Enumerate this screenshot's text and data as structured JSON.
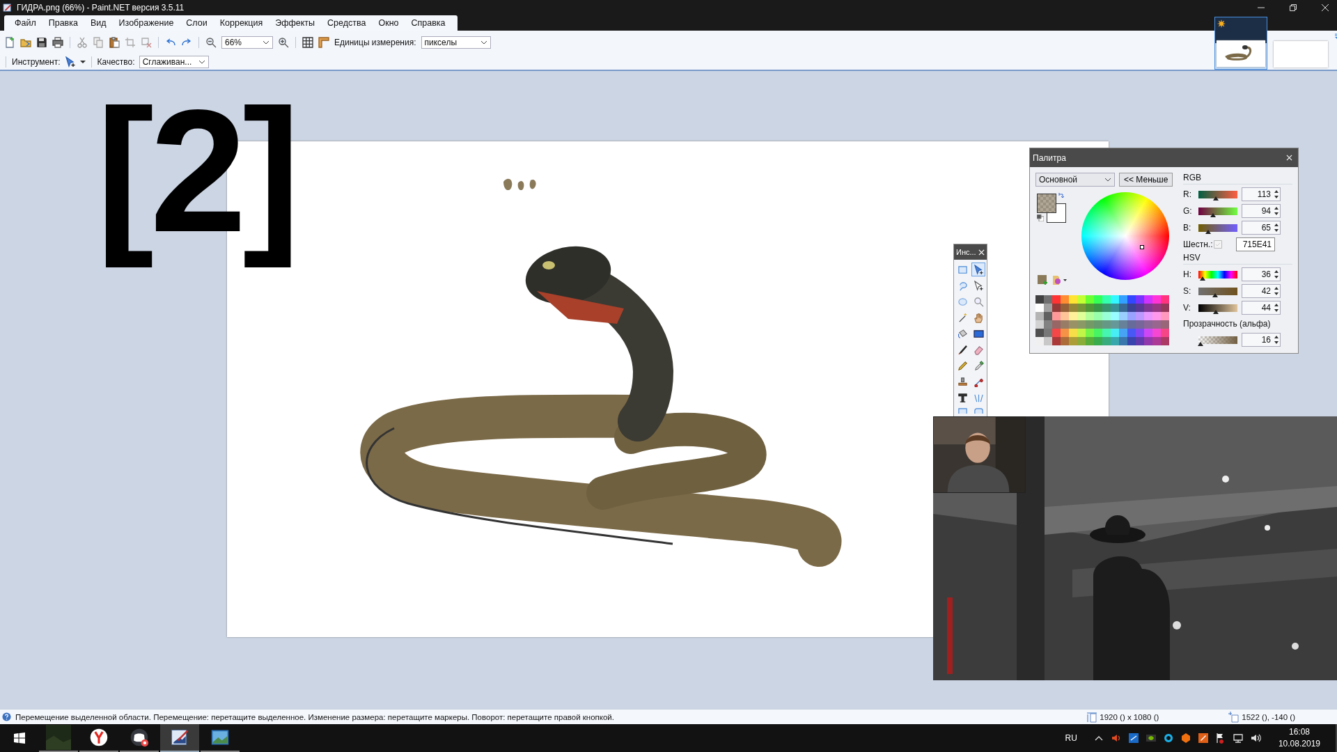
{
  "window": {
    "title": "ГИДРА.png (66%) - Paint.NET версия 3.5.11"
  },
  "menu": [
    {
      "label": "Файл"
    },
    {
      "label": "Правка"
    },
    {
      "label": "Вид"
    },
    {
      "label": "Изображение"
    },
    {
      "label": "Слои"
    },
    {
      "label": "Коррекция"
    },
    {
      "label": "Эффекты"
    },
    {
      "label": "Средства"
    },
    {
      "label": "Окно"
    },
    {
      "label": "Справка"
    }
  ],
  "image_tabs": [
    {
      "selected": true
    },
    {
      "selected": false
    }
  ],
  "toolbar": {
    "zoom": "66%",
    "units_label": "Единицы измерения:",
    "units": "пикселы"
  },
  "tool_bar": {
    "tool_label": "Инструмент:",
    "quality_label": "Качество:",
    "quality": "Сглаживан..."
  },
  "overlay_badge": "[2]",
  "tools_window": {
    "title": "Инс...",
    "tools": [
      {
        "kind": "rect-select",
        "selected": false
      },
      {
        "kind": "move-selection",
        "selected": true
      },
      {
        "kind": "lasso",
        "selected": false
      },
      {
        "kind": "move-selected",
        "selected": false
      },
      {
        "kind": "ellipse-select",
        "selected": false
      },
      {
        "kind": "zoom",
        "selected": false
      },
      {
        "kind": "magic-wand",
        "selected": false
      },
      {
        "kind": "pan",
        "selected": false
      },
      {
        "kind": "bucket",
        "selected": false
      },
      {
        "kind": "gradient",
        "selected": false
      },
      {
        "kind": "brush",
        "selected": false
      },
      {
        "kind": "eraser",
        "selected": false
      },
      {
        "kind": "pencil",
        "selected": false
      },
      {
        "kind": "picker",
        "selected": false
      },
      {
        "kind": "stamp",
        "selected": false
      },
      {
        "kind": "recolor",
        "selected": false
      },
      {
        "kind": "text",
        "selected": false
      },
      {
        "kind": "line",
        "selected": false
      },
      {
        "kind": "rectangle",
        "selected": false
      },
      {
        "kind": "rounded-rectangle",
        "selected": false
      }
    ]
  },
  "palette": {
    "title": "Палитра",
    "mode": "Основной",
    "less_button": "<< Меньше",
    "rgb_label": "RGB",
    "rgb": [
      {
        "label": "R:",
        "value": "113",
        "level": 0.44
      },
      {
        "label": "G:",
        "value": "94",
        "level": 0.37
      },
      {
        "label": "B:",
        "value": "65",
        "level": 0.25
      }
    ],
    "hex_label": "Шестн.:",
    "hex": "715E41",
    "hsv_label": "HSV",
    "hsv": [
      {
        "label": "H:",
        "value": "36",
        "level": 0.1
      },
      {
        "label": "S:",
        "value": "42",
        "level": 0.42
      },
      {
        "label": "V:",
        "value": "44",
        "level": 0.44
      }
    ],
    "alpha_label": "Прозрачность (альфа)",
    "alpha": {
      "value": "16",
      "level": 0.06
    }
  },
  "status_bar": {
    "text": "Перемещение выделенной области. Перемещение: перетащите выделенное. Изменение размера: перетащите маркеры. Поворот: перетащите правой кнопкой.",
    "size": "1920 () x 1080 ()",
    "position": "1522 (), -140 ()"
  },
  "taskbar": {
    "apps": [
      {
        "kind": "game",
        "selected": false
      },
      {
        "kind": "browser",
        "selected": false
      },
      {
        "kind": "chat",
        "selected": false
      },
      {
        "kind": "paint",
        "selected": true
      },
      {
        "kind": "photos",
        "selected": false
      }
    ],
    "language": "RU",
    "time": "16:08",
    "date": "10.08.2019"
  }
}
